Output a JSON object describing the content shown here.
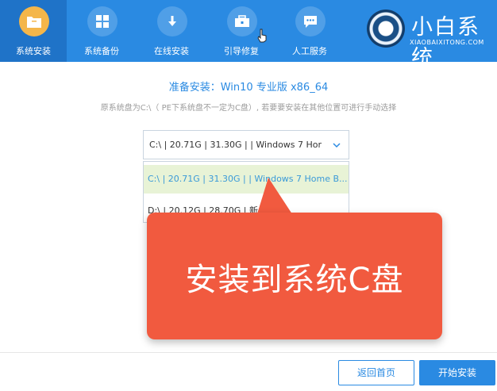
{
  "nav": {
    "items": [
      {
        "label": "系统安装",
        "icon": "folder-icon",
        "active": true
      },
      {
        "label": "系统备份",
        "icon": "windows-icon",
        "active": false
      },
      {
        "label": "在线安装",
        "icon": "download-icon",
        "active": false
      },
      {
        "label": "引导修复",
        "icon": "toolbox-icon",
        "active": false
      },
      {
        "label": "人工服务",
        "icon": "chat-icon",
        "active": false
      }
    ]
  },
  "brand": {
    "title": "小白系统",
    "subtitle": "XIAOBAIXITONG.COM"
  },
  "main": {
    "title": "准备安装：Win10 专业版 x86_64",
    "subtitle": "原系统盘为C:\\（ PE下系统盘不一定为C盘）, 若要要安装在其他位置可进行手动选择",
    "select_value": "C:\\ | 20.71G | 31.30G | | Windows 7 Hor",
    "options": [
      "C:\\ | 20.71G | 31.30G | | Windows 7 Home B...",
      "D:\\ | 20.12G | 28.70G | 新..."
    ]
  },
  "tooltip": {
    "text": "安装到系统C盘"
  },
  "footer": {
    "back_label": "返回首页",
    "start_label": "开始安装"
  },
  "colors": {
    "primary": "#2a8ae2",
    "tooltip": "#f15a3f",
    "active_icon": "#f4b64a",
    "selected_option": "#e8f3d6"
  }
}
